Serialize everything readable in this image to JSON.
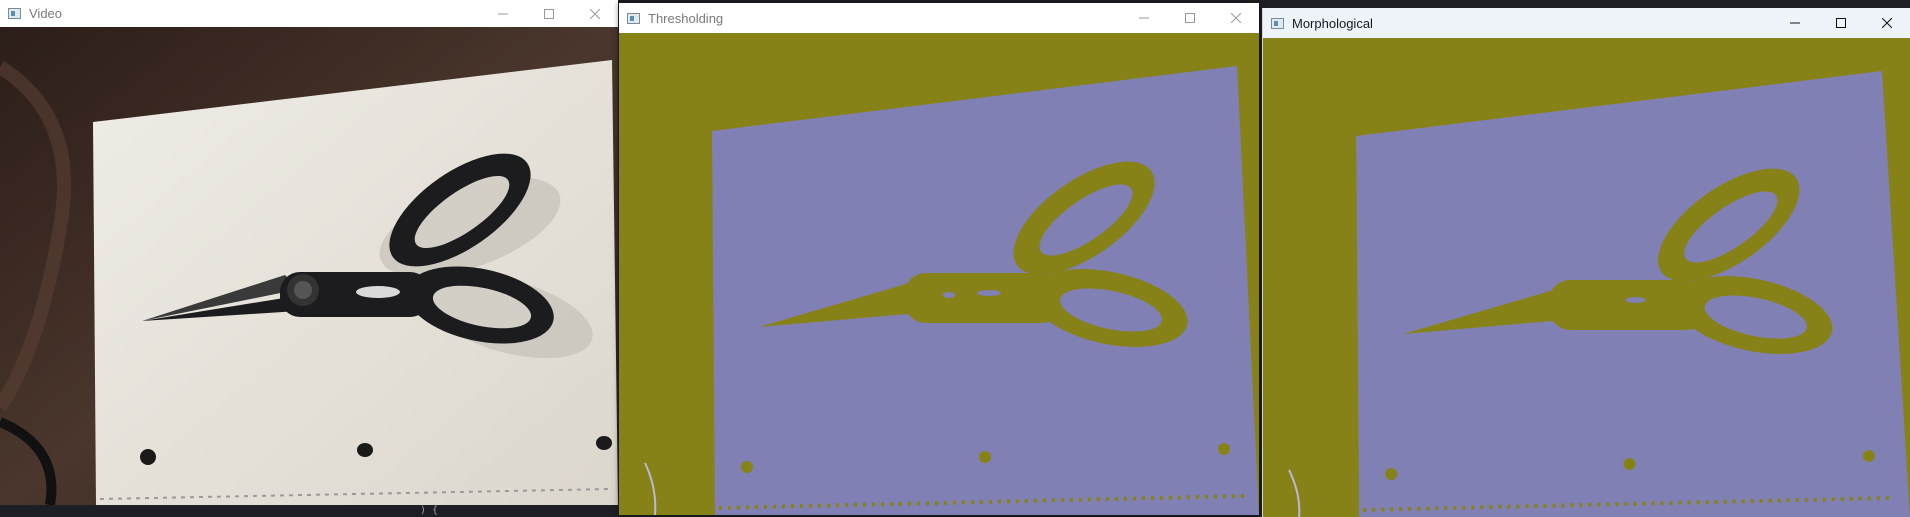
{
  "windows": [
    {
      "title": "Video"
    },
    {
      "title": "Thresholding"
    },
    {
      "title": "Morphological"
    }
  ],
  "controls": {
    "minimize": "minimize-icon",
    "maximize": "maximize-icon",
    "close": "close-icon"
  },
  "colors": {
    "threshold_foreground": "#8080b4",
    "threshold_background": "#878218",
    "paper": "#e8e4dc",
    "desk": "#3a2a22",
    "scissors": "#1c1c1e"
  },
  "background_code_fragment": ") {"
}
